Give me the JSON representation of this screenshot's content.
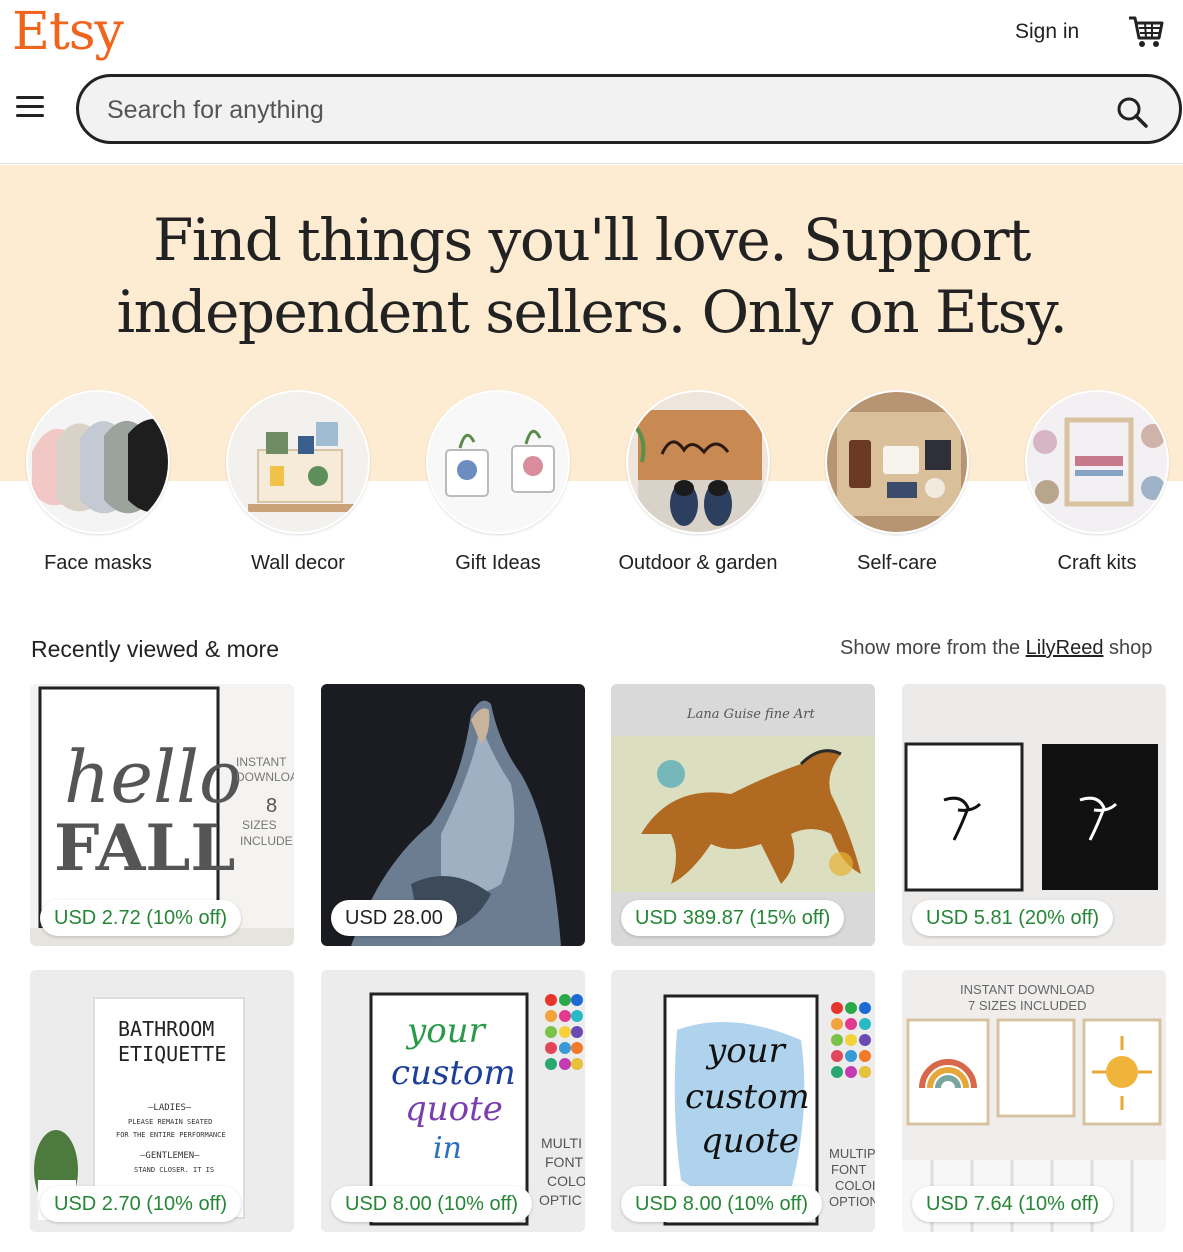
{
  "header": {
    "logo": "Etsy",
    "sign_in": "Sign in",
    "search_placeholder": "Search for anything"
  },
  "hero": {
    "line1": "Find things you'll love. Support",
    "line2": "independent sellers. Only on Etsy."
  },
  "categories": [
    {
      "label": "Face masks"
    },
    {
      "label": "Wall decor"
    },
    {
      "label": "Gift Ideas"
    },
    {
      "label": "Outdoor & garden"
    },
    {
      "label": "Self-care"
    },
    {
      "label": "Craft kits"
    }
  ],
  "recently_viewed": {
    "title": "Recently viewed & more",
    "more_prefix": "Show more from the ",
    "shop_name": "LilyReed",
    "more_suffix": " shop"
  },
  "listings": [
    {
      "price": "USD 2.72 (10% off)",
      "img_text1": "hello",
      "img_text2": "FALL",
      "side1": "INSTANT",
      "side2": "DOWNLOA",
      "side3": "8",
      "side4": "SIZES",
      "side5": "INCLUDE"
    },
    {
      "price": "USD 28.00"
    },
    {
      "price": "USD 389.87 (15% off)",
      "img_text1": "Lana Guise fine Art"
    },
    {
      "price": "USD 5.81 (20% off)"
    },
    {
      "price": "USD 2.70 (10% off)",
      "img_text1": "BATHROOM",
      "img_text2": "ETIQUETTE",
      "img_text3": "–LADIES–",
      "img_text4": "PLEASE REMAIN SEATED",
      "img_text5": "FOR THE ENTIRE PERFORMANCE",
      "img_text6": "–GENTLEMEN–",
      "img_text7": "STAND CLOSER. IT IS"
    },
    {
      "price": "USD 8.00 (10% off)",
      "img_text1": "your",
      "img_text2": "custom",
      "img_text3": "quote",
      "img_text4": "in",
      "side1": "MULTI",
      "side2": "FONT",
      "side3": "COLO",
      "side4": "OPTIC"
    },
    {
      "price": "USD 8.00 (10% off)",
      "img_text1": "your",
      "img_text2": "custom",
      "img_text3": "quote",
      "side1": "MULTIPI",
      "side2": "FONT",
      "side3": "COLOI",
      "side4": "OPTION"
    },
    {
      "price": "USD 7.64 (10% off)",
      "img_text1": "INSTANT DOWNLOAD",
      "img_text2": "7 SIZES INCLUDED"
    }
  ],
  "colors": {
    "brand": "#F1641E",
    "hero_bg": "#FDEBD2",
    "sale_green": "#258635"
  }
}
